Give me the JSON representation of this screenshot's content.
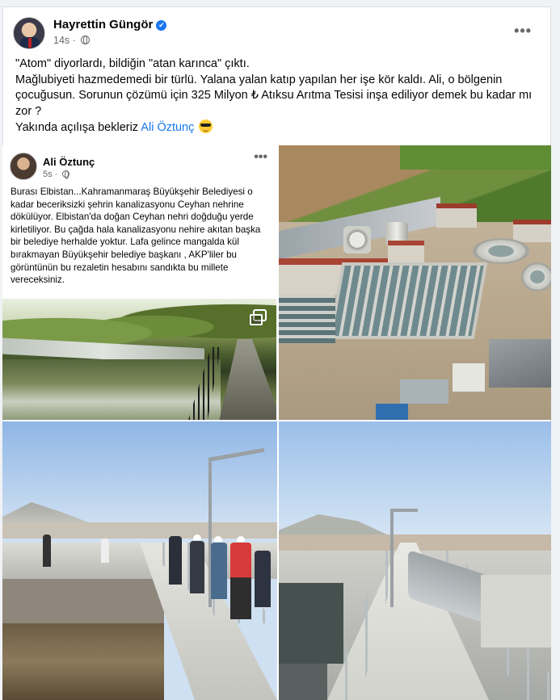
{
  "post": {
    "author": "Hayrettin Güngör",
    "verified_mark": "✔",
    "time": "14s",
    "audience_icon": "globe-icon",
    "more_icon": "more-options-icon",
    "lines": [
      "\"Atom\" diyorlardı, bildiğin \"atan karınca\" çıktı.",
      "Mağlubiyeti hazmedemedi bir türlü. Yalana yalan katıp yapılan her işe kör kaldı. Ali, o bölgenin çocuğusun. Sorunun çözümü için 325 Milyon ₺ Atıksu Arıtma Tesisi inşa ediliyor demek bu kadar mı zor ?"
    ],
    "last_line_prefix": "Yakında açılışa bekleriz ",
    "mention": "Ali Öztunç",
    "emoji": "smiling-face-with-sunglasses"
  },
  "shared_post": {
    "author": "Ali Öztunç",
    "time": "5s",
    "text": "Burası Elbistan...Kahramanmaraş Büyükşehir Belediyesi o kadar beceriksizki şehrin kanalizasyonu Ceyhan nehrine dökülüyor. Elbistan'da doğan Ceyhan nehri doğduğu yerde kirletiliyor. Bu çağda hala kanalizasyonu nehire akıtan başka bir belediye herhalde yoktur. Lafa gelince mangalda kül bırakmayan Büyükşehir belediye başkanı , AKP'liler bu görüntünün bu rezaletin hesabını sandıkta bu millete vereceksiniz.",
    "video_icon": "picture-in-picture-icon"
  },
  "colors": {
    "link": "#1877f2",
    "secondary_text": "#65676b",
    "verified": "#1877f2"
  }
}
